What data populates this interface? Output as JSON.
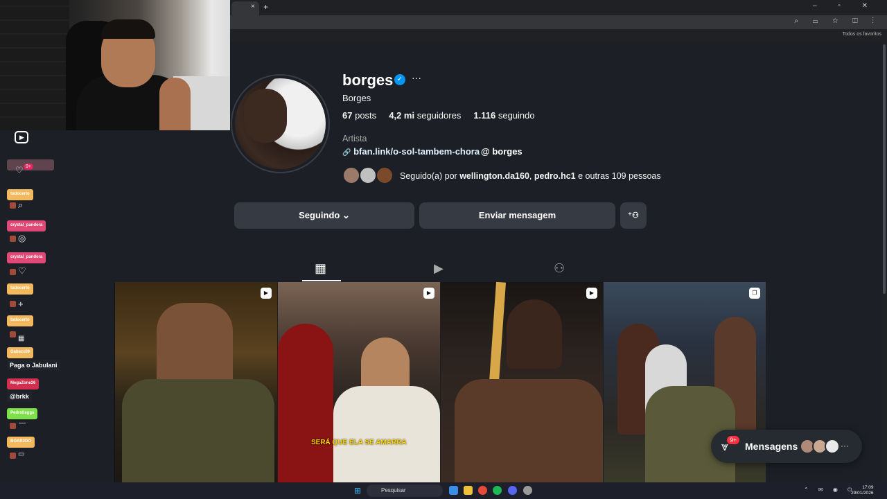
{
  "browser": {
    "tab_close": "×",
    "new_tab": "+",
    "window_controls": "– ▫ ✕",
    "address_icons": "⌕ ▭ ☆ ◫ ⋮",
    "bookmarks_label": "Todos os favoritos"
  },
  "overlay": {
    "logo_icon": "play-icon",
    "chat": [
      {
        "user": "tudocerto",
        "color": "orange",
        "icon": "⌕"
      },
      {
        "user": "crystal_pandora",
        "color": "pink",
        "icon": "◎"
      },
      {
        "user": "crystal_pandora",
        "color": "pink",
        "icon": "♡"
      },
      {
        "user": "tudocerto",
        "color": "orange",
        "icon": "+"
      },
      {
        "user": "tudocerto",
        "color": "orange",
        "icon": "▦"
      },
      {
        "user": "Gabezx09",
        "color": "orange",
        "icon": "",
        "message": "Paga o Jabulani"
      },
      {
        "user": "MegaZone26",
        "color": "red",
        "icon": "",
        "message": "@brkk"
      },
      {
        "user": "Pedrolleggs",
        "color": "green",
        "icon": "—"
      },
      {
        "user": "BOAR2DO",
        "color": "orange",
        "icon": "▭"
      }
    ],
    "badge": "9+"
  },
  "profile": {
    "username": "borges",
    "verified_icon": "✓",
    "more": "···",
    "full_name": "Borges",
    "posts_count": "67",
    "posts_label": "posts",
    "followers_count": "4,2 mi",
    "followers_label": "seguidores",
    "following_count": "1.116",
    "following_label": "seguindo",
    "category": "Artista",
    "link_icon": "🔗",
    "link": "bfan.link/o-sol-tambem-chora",
    "threads_icon": "@",
    "threads_handle": "borges",
    "followed_by_prefix": "Seguido(a) por",
    "followed_by_user1": "wellington.da160",
    "followed_by_sep": ",",
    "followed_by_user2": "pedro.hc1",
    "followed_by_suffix": "e outras 109 pessoas"
  },
  "actions": {
    "following_button": "Seguindo ⌄",
    "message_button": "Enviar mensagem",
    "suggest_icon": "⁺⚇"
  },
  "tabs": {
    "posts_icon": "▦",
    "reels_icon": "▶",
    "tagged_icon": "⚇"
  },
  "posts": [
    {
      "type_icon": "▶",
      "type": "reel"
    },
    {
      "type_icon": "▶",
      "type": "reel",
      "caption": "SERÁ QUE ELA SE AMARRA"
    },
    {
      "type_icon": "▶",
      "type": "reel"
    },
    {
      "type_icon": "❐",
      "type": "carousel"
    }
  ],
  "messages": {
    "icon": "⩔",
    "badge": "9+",
    "label": "Mensagens",
    "more": "···"
  },
  "taskbar": {
    "start_icon": "⊞",
    "search_placeholder": "Pesquisar",
    "tray_icons": "⌃ ✉ ◉ ⏻",
    "time": "17:09",
    "date": "29/01/2026"
  },
  "colors": {
    "page_bg": "#1c2026",
    "verified": "#0095f6",
    "button_bg": "#363a42",
    "caption": "#ffd400"
  }
}
